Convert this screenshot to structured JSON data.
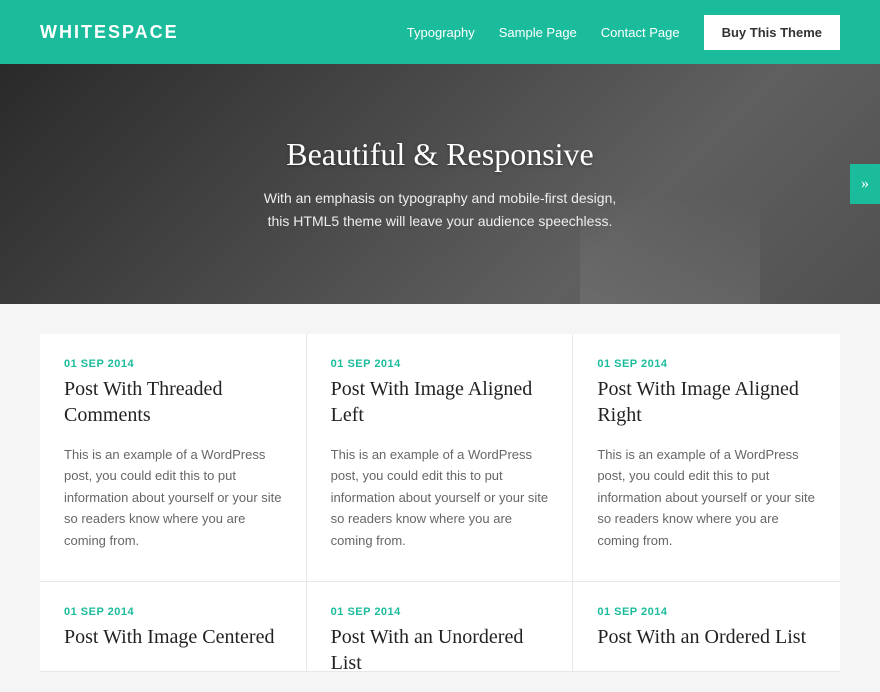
{
  "header": {
    "site_title": "WHITESPACE",
    "nav": {
      "typography": "Typography",
      "sample_page": "Sample Page",
      "contact_page": "Contact Page",
      "buy_button": "Buy This Theme"
    }
  },
  "hero": {
    "heading": "Beautiful & Responsive",
    "subheading": "With an emphasis on typography and mobile-first design,\nthis HTML5 theme will leave your audience speechless.",
    "next_arrow": "»"
  },
  "posts": [
    {
      "date": "01 SEP 2014",
      "title": "Post With Threaded Comments",
      "excerpt": "This is an example of a WordPress post, you could edit this to put information about yourself or your site so readers know where you are coming from."
    },
    {
      "date": "01 SEP 2014",
      "title": "Post With Image Aligned Left",
      "excerpt": "This is an example of a WordPress post, you could edit this to put information about yourself or your site so readers know where you are coming from."
    },
    {
      "date": "01 SEP 2014",
      "title": "Post With Image Aligned Right",
      "excerpt": "This is an example of a WordPress post, you could edit this to put information about yourself or your site so readers know where you are coming from."
    }
  ],
  "posts_bottom": [
    {
      "date": "01 SEP 2014",
      "title": "Post With Image Centered"
    },
    {
      "date": "01 SEP 2014",
      "title": "Post With an Unordered List"
    },
    {
      "date": "01 SEP 2014",
      "title": "Post With an Ordered List"
    }
  ],
  "colors": {
    "teal": "#1abc9c"
  }
}
